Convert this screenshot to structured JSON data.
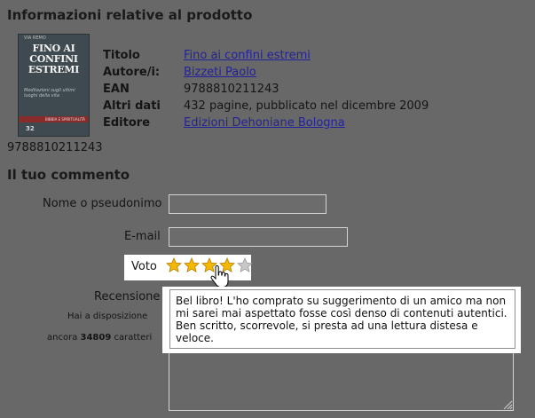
{
  "product": {
    "heading": "Informazioni relative al prodotto",
    "cover_alt": {
      "top_text": "VIA REMO",
      "title": "FINO AI CONFINI ESTREMI",
      "subtitle": "Meditazioni sugli ultimi luoghi della vita",
      "band": "BIBBIA E SPIRITUALITÀ",
      "number": "32"
    },
    "isbn_below_cover": "9788810211243",
    "fields": [
      {
        "label": "Titolo",
        "value": "Fino ai confini estremi",
        "link": true
      },
      {
        "label": "Autore/i:",
        "value": "Bizzeti Paolo",
        "link": true
      },
      {
        "label": "EAN",
        "value": "9788810211243",
        "link": false
      },
      {
        "label": "Altri dati",
        "value": "432 pagine, pubblicato nel dicembre 2009",
        "link": false
      },
      {
        "label": "Editore",
        "value": "Edizioni Dehoniane Bologna",
        "link": true
      }
    ]
  },
  "comment": {
    "heading": "Il tuo commento",
    "name_label": "Nome o pseudonimo",
    "name_value": "",
    "email_label": "E-mail",
    "email_value": "",
    "rating_label": "Voto",
    "rating": {
      "value": 4,
      "max": 5
    },
    "review_label": "Recensione",
    "remaining_line1": "Hai a disposizione",
    "remaining_prefix": "ancora ",
    "remaining_count": "34809",
    "remaining_suffix": " caratteri",
    "review_text": "Bel libro! L'ho comprato su suggerimento di un amico ma non mi sarei mai aspettato fosse così denso di contenuti autentici. Ben scritto, scorrevole, si presta ad una lettura distesa e veloce."
  },
  "colors": {
    "background": "#686868",
    "link": "#23229a",
    "star_filled": "#f5b800",
    "star_empty": "#c8c8c8"
  },
  "icons": {
    "rating_star": "star-icon",
    "cursor": "hand-pointer-icon",
    "resize": "resize-grip-icon"
  }
}
